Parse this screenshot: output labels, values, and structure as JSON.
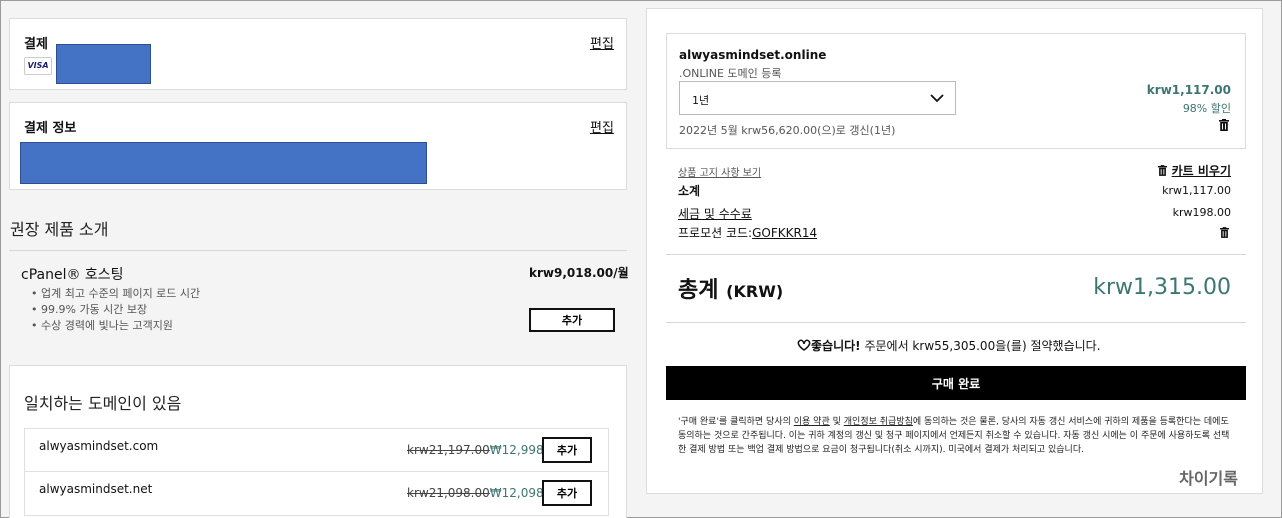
{
  "payment": {
    "title": "결제",
    "edit_label": "편집",
    "card_brand": "VISA"
  },
  "payment_info": {
    "title": "결제 정보",
    "edit_label": "편집"
  },
  "recommended": {
    "heading": "권장 제품 소개",
    "product": {
      "name": "cPanel® 호스팅",
      "price": "krw9,018.00/월",
      "features": [
        "업계 최고 수준의 페이지 로드 시간",
        "99.9% 가동 시간 보장",
        "수상 경력에 빛나는 고객지원"
      ],
      "add_label": "추가"
    }
  },
  "matching": {
    "heading": "일치하는 도메인이 있음",
    "items": [
      {
        "domain": "alwyasmindset.com",
        "old_price": "krw21,197.00",
        "new_price": "₩12,998",
        "add_label": "추가"
      },
      {
        "domain": "alwyasmindset.net",
        "old_price": "krw21,098.00",
        "new_price": "₩12,098",
        "add_label": "추가"
      }
    ]
  },
  "cart_item": {
    "domain": "alwyasmindset.online",
    "subtitle": ".ONLINE 도메인 등록",
    "term_value": "1년",
    "renewal_text": "2022년 5월 krw56,620.00(으)로 갱신(1년)",
    "price": "krw1,117.00",
    "discount": "98% 할인"
  },
  "summary": {
    "notice_link": "상품 고지 사항 보기",
    "empty_cart": "카트 비우기",
    "subtotal_label": "소계",
    "subtotal_value": "krw1,117.00",
    "tax_label": "세금 및 수수료",
    "tax_value": "krw198.00",
    "promo_label": "프로모션 코드:",
    "promo_code": "GOFKKR14",
    "total_label": "총계",
    "total_currency": "(KRW)",
    "total_value": "krw1,315.00",
    "savings_bold": "좋습니다!",
    "savings_text": " 주문에서 krw55,305.00을(를) 절약했습니다.",
    "checkout_label": "구매 완료"
  },
  "legal": {
    "p1": "'구매 완료'를 클릭하면 당사의 ",
    "terms": "이용 약관",
    "and": " 및 ",
    "privacy": "개인정보 취급방침",
    "p2": "에 동의하는 것은 물론, 당사의 자동 갱신 서비스에 귀하의 제품을 등록한다는 데에도 동의하는 것으로 간주됩니다. 이는 귀하 계정의 갱신 및 청구 페이지에서 언제든지 취소할 수 있습니다. 자동 갱신 시에는 이 주문에 사용하도록 선택한 결제 방법 또는 백업 결제 방법으로 요금이 청구됩니다(취소 시까지). 미국에서 결제가 처리되고 있습니다."
  },
  "watermark": "차이기록",
  "colors": {
    "accent": "#3d7573",
    "mask": "#4472c4",
    "checkout": "#000000"
  }
}
